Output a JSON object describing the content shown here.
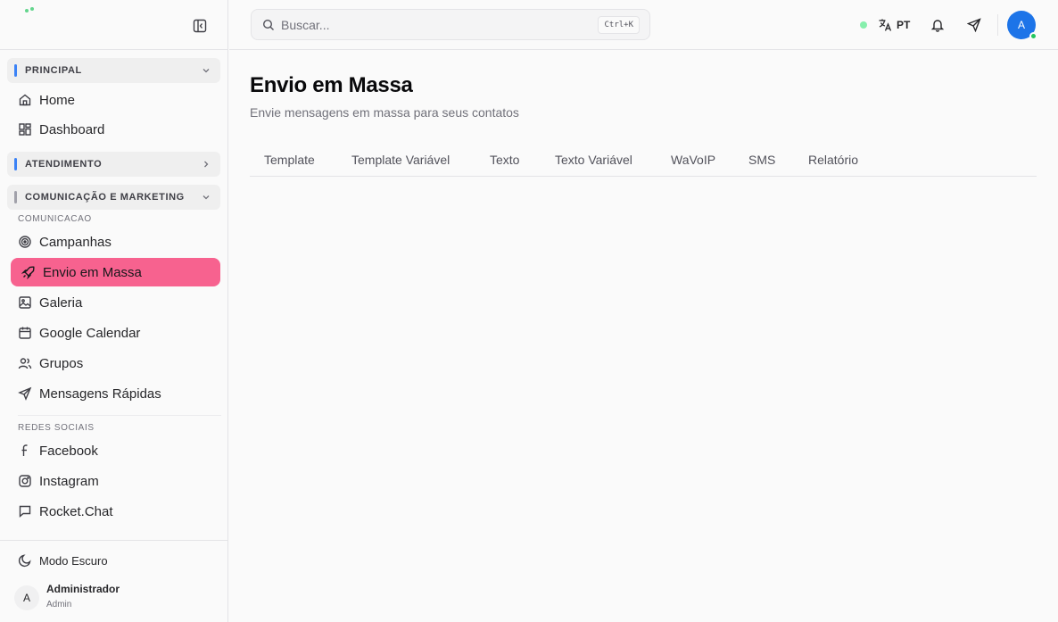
{
  "sidebar": {
    "sections": {
      "principal": {
        "label": "PRINCIPAL",
        "accent": "#3b82f6"
      },
      "atendimento": {
        "label": "ATENDIMENTO",
        "accent": "#3b82f6"
      },
      "comunicacao": {
        "label": "COMUNICAÇÃO E MARKETING",
        "accent": "#a1a1aa"
      }
    },
    "principal_items": [
      {
        "label": "Home",
        "icon": "home-icon"
      },
      {
        "label": "Dashboard",
        "icon": "dashboard-icon"
      }
    ],
    "sub_comunicacao": "COMUNICACAO",
    "comunicacao_items": [
      {
        "label": "Campanhas",
        "icon": "target-icon"
      },
      {
        "label": "Envio em Massa",
        "icon": "rocket-icon",
        "active": true
      },
      {
        "label": "Galeria",
        "icon": "image-icon"
      },
      {
        "label": "Google Calendar",
        "icon": "calendar-icon"
      },
      {
        "label": "Grupos",
        "icon": "users-icon"
      },
      {
        "label": "Mensagens Rápidas",
        "icon": "send-icon"
      }
    ],
    "sub_redes": "REDES SOCIAIS",
    "redes_items": [
      {
        "label": "Facebook",
        "icon": "facebook-icon"
      },
      {
        "label": "Instagram",
        "icon": "instagram-icon"
      },
      {
        "label": "Rocket.Chat",
        "icon": "chat-icon"
      }
    ],
    "dark_mode_label": "Modo Escuro",
    "user": {
      "initial": "A",
      "name": "Administrador",
      "role": "Admin"
    }
  },
  "header": {
    "search_placeholder": "Buscar...",
    "search_shortcut": "Ctrl+K",
    "language": "PT",
    "avatar_initial": "A",
    "avatar_color": "#1d74e8"
  },
  "main": {
    "title": "Envio em Massa",
    "subtitle": "Envie mensagens em massa para seus contatos",
    "tabs": [
      "Template",
      "Template Variável",
      "Texto",
      "Texto Variável",
      "WaVoIP",
      "SMS",
      "Relatório"
    ]
  },
  "colors": {
    "active_nav": "#f7628f",
    "online": "#22c55e"
  }
}
